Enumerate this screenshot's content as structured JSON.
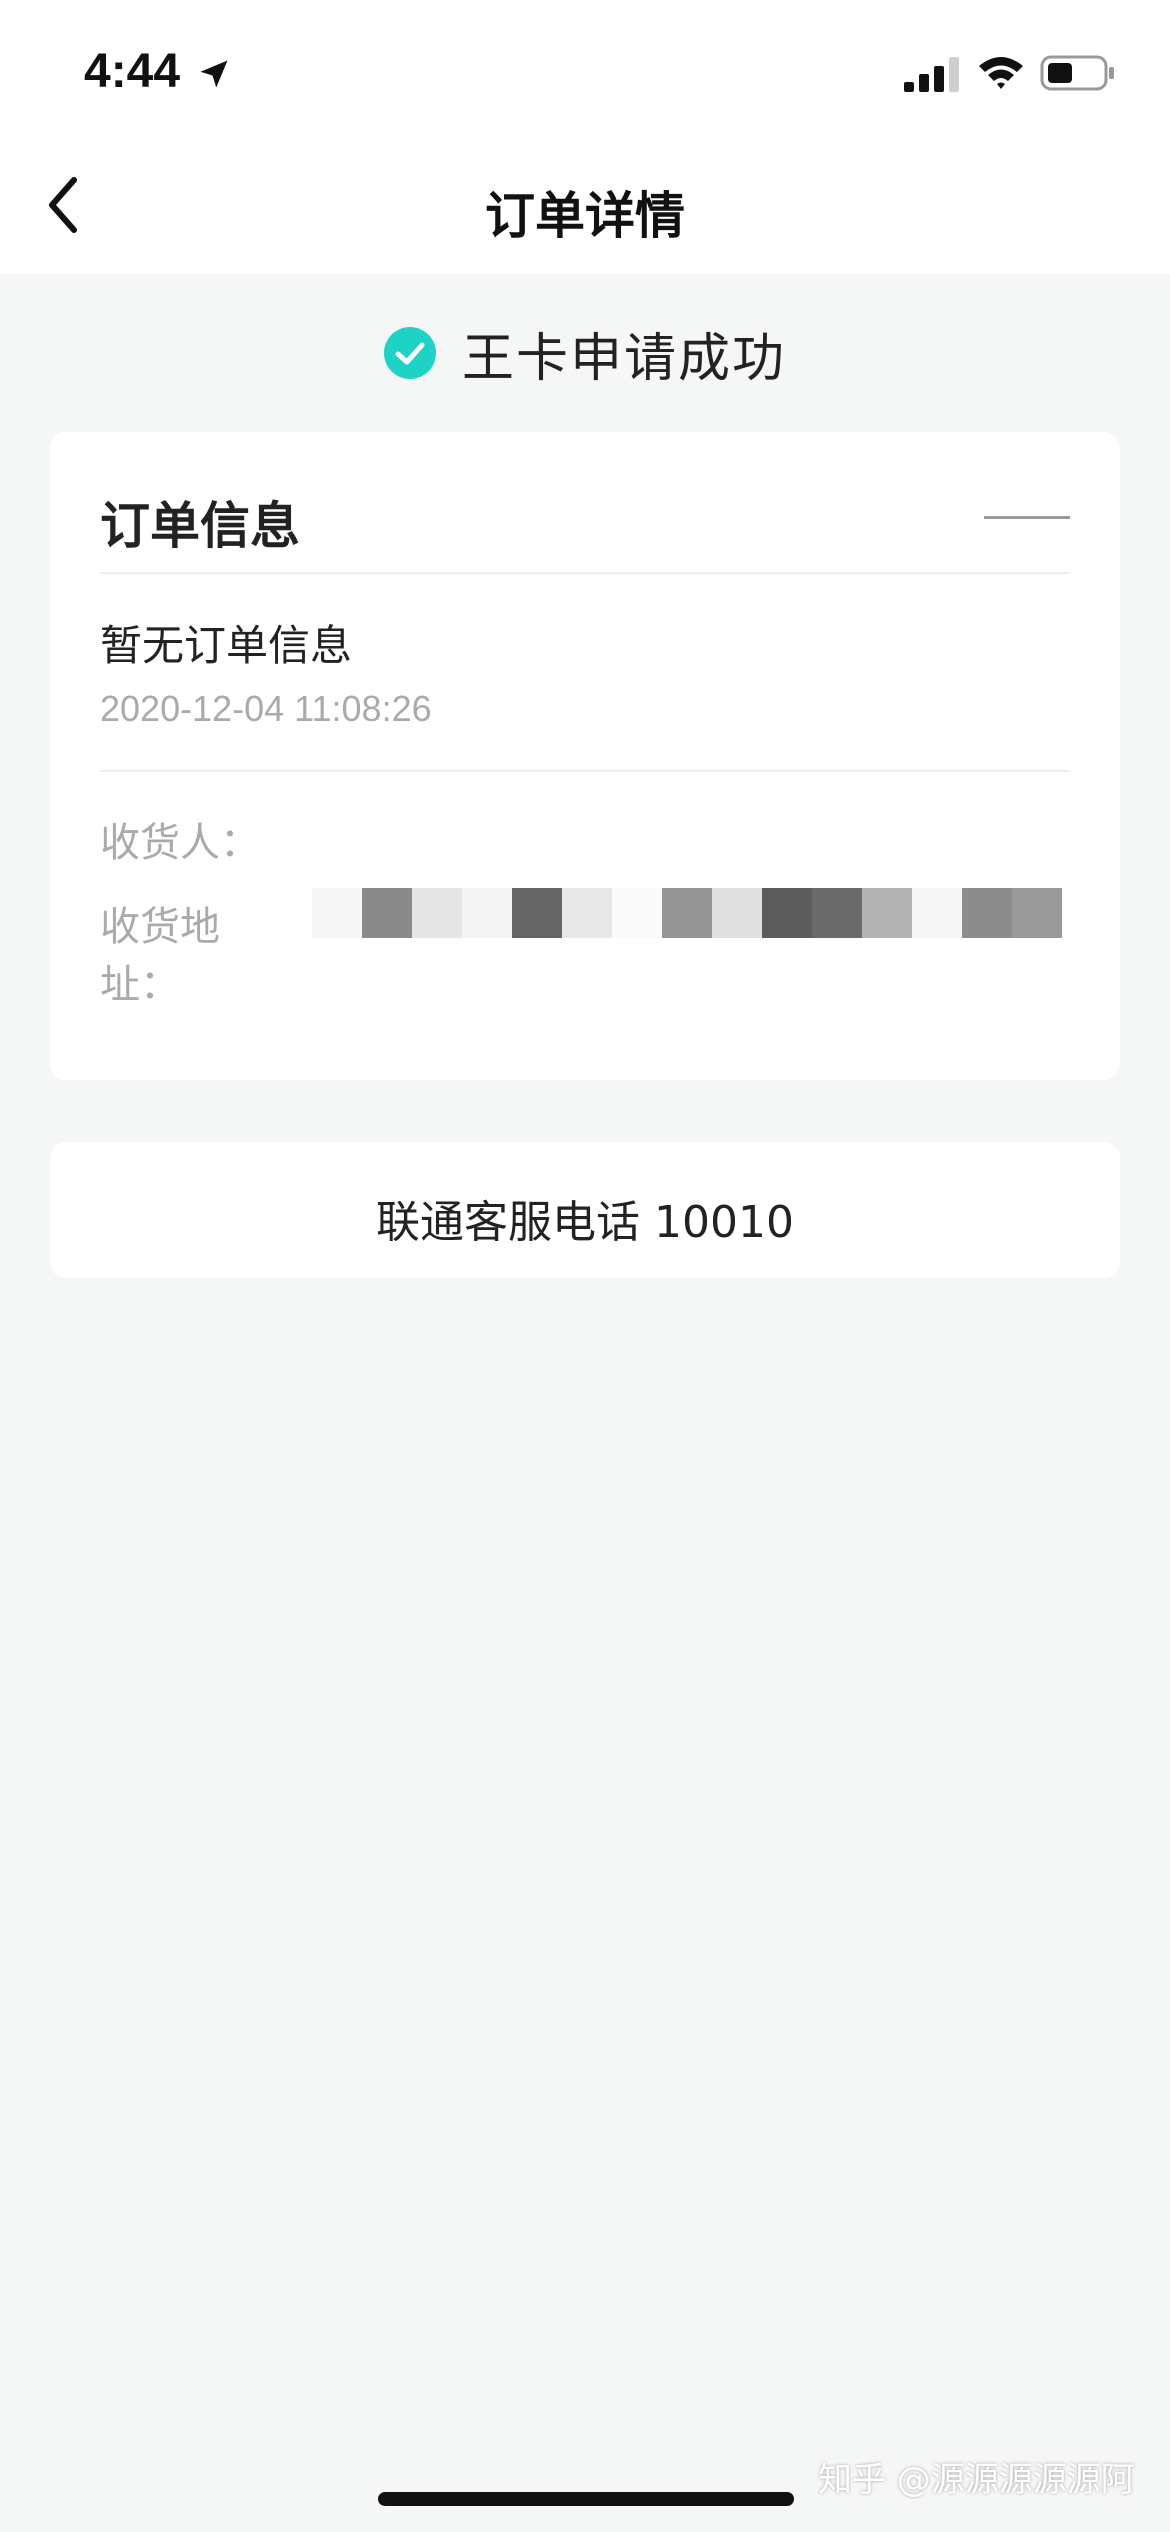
{
  "status_bar": {
    "time": "4:44",
    "icons": [
      "location-arrow-icon",
      "cellular-signal-icon",
      "wifi-icon",
      "battery-icon"
    ]
  },
  "nav": {
    "title": "订单详情",
    "back_icon": "chevron-left-icon"
  },
  "result": {
    "icon": "check-circle-icon",
    "text": "王卡申请成功",
    "accent_color": "#1dd3c6"
  },
  "order_card": {
    "title": "订单信息",
    "collapse_icon": "collapse-dash-icon",
    "status": "暂无订单信息",
    "time": "2020-12-04 11:08:26",
    "receiver_label": "收货人：",
    "address_label": "收货地址："
  },
  "service": {
    "text": "联通客服电话 10010"
  },
  "watermark": "知乎 @源源源源源阿"
}
